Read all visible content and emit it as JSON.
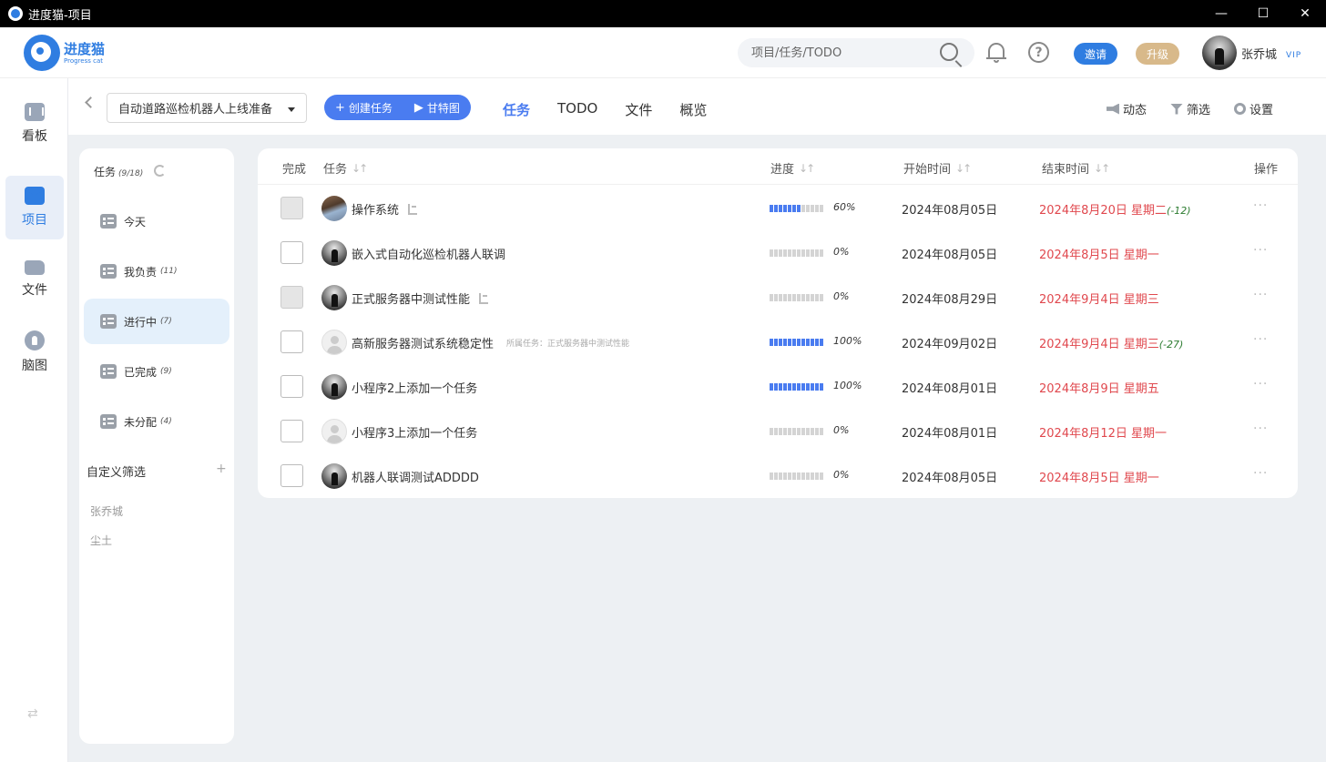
{
  "window": {
    "title": "进度猫-项目",
    "controls": [
      "—",
      "☐",
      "✕"
    ]
  },
  "logo": {
    "cn": "进度猫",
    "en": "Progress cat"
  },
  "header": {
    "search_placeholder": "项目/任务/TODO",
    "invite_label": "邀请",
    "upgrade_label": "升级",
    "user_name": "张乔城",
    "vip_label": "VIP"
  },
  "rail": {
    "items": [
      {
        "label": "看板",
        "icon": "dashboard-icon"
      },
      {
        "label": "项目",
        "icon": "layers-icon",
        "active": true
      },
      {
        "label": "文件",
        "icon": "folder-icon"
      },
      {
        "label": "脑图",
        "icon": "bulb-icon"
      }
    ],
    "swap_glyph": "⇄"
  },
  "toolbar": {
    "project_name": "自动道路巡检机器人上线准备",
    "create_task_label": "创建任务",
    "gantt_label": "甘特图",
    "tabs": [
      "任务",
      "TODO",
      "文件",
      "概览"
    ],
    "active_tab": "任务",
    "activity_label": "动态",
    "filter_label": "筛选",
    "settings_label": "设置"
  },
  "filter_panel": {
    "title": "任务",
    "title_count": "(9/18)",
    "items": [
      {
        "label": "今天",
        "count": ""
      },
      {
        "label": "我负责",
        "count": "(11)"
      },
      {
        "label": "进行中",
        "count": "(7)",
        "active": true
      },
      {
        "label": "已完成",
        "count": "(9)"
      },
      {
        "label": "未分配",
        "count": "(4)"
      }
    ],
    "custom_filter_label": "自定义筛选",
    "plus_glyph": "+",
    "users": [
      "张乔城",
      "尘土"
    ]
  },
  "table": {
    "headers": {
      "done": "完成",
      "task": "任务",
      "progress": "进度",
      "start": "开始时间",
      "end": "结束时间",
      "actions": "操作"
    },
    "sort_glyph": "↓↑",
    "more_glyph": "···",
    "rows": [
      {
        "name": "操作系统",
        "avatar": "photo",
        "checkbox_filled": true,
        "subtask_icon": true,
        "parent": "",
        "progress": 60,
        "progress_label": "60%",
        "start": "2024年08月05日",
        "end": "2024年8月20日 星期二",
        "overdue": "(-12)"
      },
      {
        "name": "嵌入式自动化巡检机器人联调",
        "avatar": "dark",
        "checkbox_filled": false,
        "subtask_icon": false,
        "parent": "",
        "progress": 0,
        "progress_label": "0%",
        "start": "2024年08月05日",
        "end": "2024年8月5日 星期一",
        "overdue": ""
      },
      {
        "name": "正式服务器中测试性能",
        "avatar": "dark",
        "checkbox_filled": true,
        "subtask_icon": true,
        "parent": "",
        "progress": 0,
        "progress_label": "0%",
        "start": "2024年08月29日",
        "end": "2024年9月4日 星期三",
        "overdue": ""
      },
      {
        "name": "高新服务器测试系统稳定性",
        "avatar": "blank",
        "checkbox_filled": false,
        "subtask_icon": false,
        "parent": "所属任务：正式服务器中测试性能",
        "progress": 100,
        "progress_label": "100%",
        "start": "2024年09月02日",
        "end": "2024年9月4日 星期三",
        "overdue": "(-27)"
      },
      {
        "name": "小程序2上添加一个任务",
        "avatar": "dark",
        "checkbox_filled": false,
        "subtask_icon": false,
        "parent": "",
        "progress": 100,
        "progress_label": "100%",
        "start": "2024年08月01日",
        "end": "2024年8月9日 星期五",
        "overdue": ""
      },
      {
        "name": "小程序3上添加一个任务",
        "avatar": "blank",
        "checkbox_filled": false,
        "subtask_icon": false,
        "parent": "",
        "progress": 0,
        "progress_label": "0%",
        "start": "2024年08月01日",
        "end": "2024年8月12日 星期一",
        "overdue": ""
      },
      {
        "name": "机器人联调测试ADDDD",
        "avatar": "dark",
        "checkbox_filled": false,
        "subtask_icon": false,
        "parent": "",
        "progress": 0,
        "progress_label": "0%",
        "start": "2024年08月05日",
        "end": "2024年8月5日 星期一",
        "overdue": ""
      }
    ]
  },
  "colors": {
    "accent": "#4a7cf0",
    "brand": "#2f7de1",
    "overdue_red": "#e0484e",
    "gold": "#d8b98a"
  }
}
